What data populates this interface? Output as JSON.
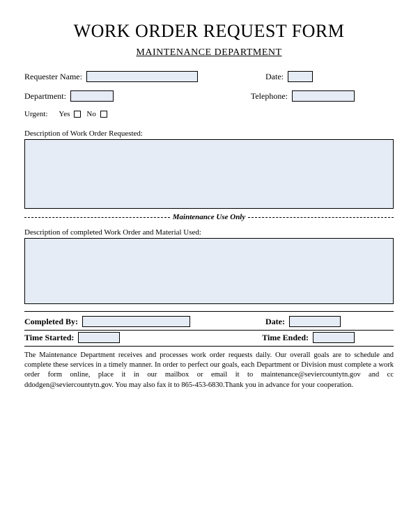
{
  "title": "WORK ORDER REQUEST FORM",
  "subtitle": "MAINTENANCE DEPARTMENT",
  "fields": {
    "requester_name_label": "Requester Name:",
    "date_label": "Date:",
    "department_label": "Department:",
    "telephone_label": "Telephone:",
    "urgent_label": "Urgent:",
    "yes_label": "Yes",
    "no_label": "No",
    "description_requested_label": "Description of Work Order Requested:",
    "description_completed_label": "Description of completed Work Order and Material Used:",
    "completed_by_label": "Completed By:",
    "date2_label": "Date:",
    "time_started_label": "Time Started:",
    "time_ended_label": "Time Ended:"
  },
  "divider_text": "Maintenance Use Only",
  "footer_text": "The Maintenance Department receives and processes work order requests daily. Our overall goals are to schedule and complete these services in a timely manner.  In order to perfect our goals, each Department or Division must complete a work order form online, place it in our mailbox or email it to maintenance@seviercountytn.gov and cc ddodgen@seviercountytn.gov. You may also fax it to 865-453-6830.Thank you in advance for your cooperation."
}
